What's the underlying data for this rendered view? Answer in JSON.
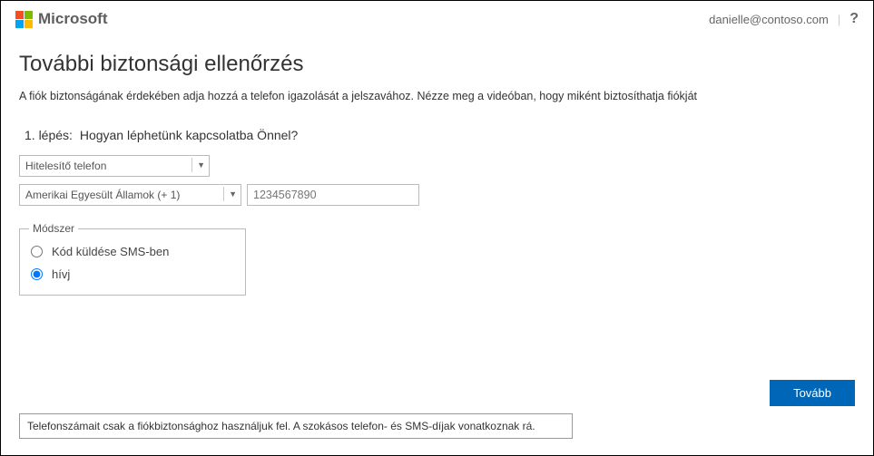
{
  "header": {
    "brand": "Microsoft",
    "user_email": "danielle@contoso.com",
    "help_symbol": "?"
  },
  "page": {
    "title": "További biztonsági ellenőrzés",
    "subtitle": "A fiók biztonságának érdekében adja hozzá a telefon igazolását a jelszavához. Nézze meg a videóban, hogy miként biztosíthatja fiókját",
    "step_prefix": "1. lépés:",
    "step_question": "Hogyan léphetünk kapcsolatba Önnel?",
    "contact_method_selected": "Hitelesítő telefon",
    "country_selected": "Amerikai Egyesült Államok (+ 1)",
    "phone_placeholder": "1234567890",
    "method_legend": "Módszer",
    "method_sms": "Kód küldése SMS-ben",
    "method_call": "hívj",
    "next_button": "Tovább",
    "footnote": "Telefonszámait csak a fiókbiztonsághoz használjuk fel. A szokásos telefon- és SMS-díjak vonatkoznak rá."
  }
}
